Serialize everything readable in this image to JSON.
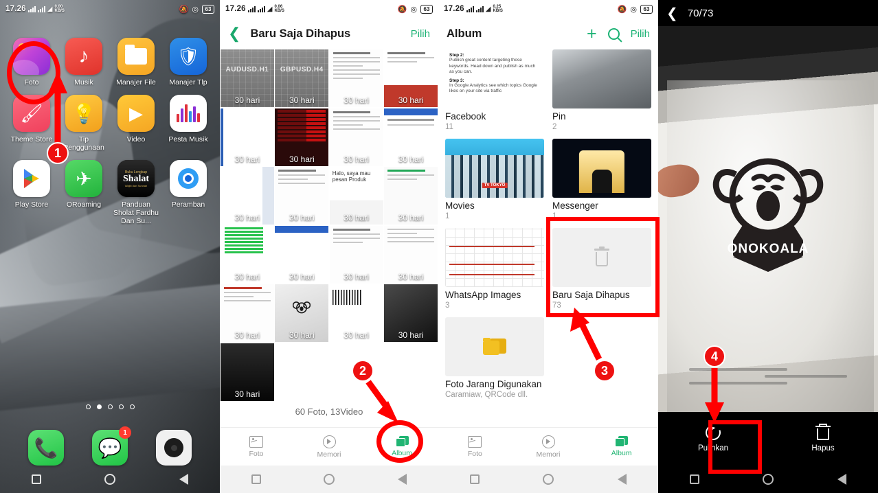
{
  "panels": {
    "home": {
      "status": {
        "time": "17.26",
        "speed_value": "0.00",
        "speed_unit": "KB/S",
        "battery": "63"
      },
      "apps": [
        {
          "label": "Foto",
          "icon": "photos-icon"
        },
        {
          "label": "Musik",
          "icon": "music-note-icon"
        },
        {
          "label": "Manajer File",
          "icon": "folder-icon"
        },
        {
          "label": "Manajer Tlp",
          "icon": "shield-bolt-icon"
        },
        {
          "label": "Theme Store",
          "icon": "brush-icon"
        },
        {
          "label": "Tip Penggunaan",
          "icon": "lightbulb-icon"
        },
        {
          "label": "Video",
          "icon": "play-triangle-icon"
        },
        {
          "label": "Pesta Musik",
          "icon": "equalizer-icon"
        },
        {
          "label": "Play Store",
          "icon": "play-store-icon"
        },
        {
          "label": "ORoaming",
          "icon": "airplane-icon"
        },
        {
          "label": "Panduan Sholat Fardhu Dan Su...",
          "icon": "shalat-book-icon"
        },
        {
          "label": "Peramban",
          "icon": "browser-icon"
        }
      ],
      "shalat_cover": {
        "top": "Buku Lengkap",
        "main": "Shalat",
        "bottom": "Wajib dan Sunnah"
      },
      "page_dots": 5,
      "active_dot": 1,
      "dock": [
        {
          "label": "Phone",
          "icon": "phone-icon",
          "badge": ""
        },
        {
          "label": "Messages",
          "icon": "message-icon",
          "badge": "1"
        },
        {
          "label": "Camera",
          "icon": "camera-icon",
          "badge": ""
        }
      ]
    },
    "recently_deleted": {
      "status": {
        "time": "17.26",
        "speed_value": "0.06",
        "speed_unit": "KB/S",
        "battery": "63"
      },
      "back_icon": "chevron-left-icon",
      "title": "Baru Saja Dihapus",
      "select_label": "Pilih",
      "footer_count": "60 Foto, 13Video",
      "thumb_badge": "30 hari",
      "thumbs": [
        {
          "kind": "chart",
          "caption": "AUDUSD.H1"
        },
        {
          "kind": "chart",
          "caption": "GBPUSD.H4"
        },
        {
          "kind": "doc",
          "caption": ""
        },
        {
          "kind": "chart-red",
          "caption": ""
        },
        {
          "kind": "white-chart",
          "caption": ""
        },
        {
          "kind": "red-table",
          "caption": ""
        },
        {
          "kind": "doc",
          "caption": ""
        },
        {
          "kind": "doc-blue",
          "caption": ""
        },
        {
          "kind": "white-chart",
          "caption": ""
        },
        {
          "kind": "doc",
          "caption": ""
        },
        {
          "kind": "wa",
          "caption": "Halo, saya mau pesan Produk"
        },
        {
          "kind": "doc",
          "caption": ""
        },
        {
          "kind": "green-table",
          "caption": ""
        },
        {
          "kind": "blue-chart",
          "caption": ""
        },
        {
          "kind": "doc",
          "caption": ""
        },
        {
          "kind": "doc",
          "caption": ""
        },
        {
          "kind": "doc",
          "caption": ""
        },
        {
          "kind": "bag",
          "caption": ""
        },
        {
          "kind": "barcode",
          "caption": ""
        },
        {
          "kind": "dark",
          "caption": ""
        },
        {
          "kind": "night",
          "caption": ""
        }
      ],
      "tabs": [
        {
          "label": "Foto",
          "icon": "photo-tab-icon",
          "active": false
        },
        {
          "label": "Memori",
          "icon": "memory-tab-icon",
          "active": false
        },
        {
          "label": "Album",
          "icon": "album-tab-icon",
          "active": true
        }
      ]
    },
    "album_list": {
      "status": {
        "time": "17.26",
        "speed_value": "0.25",
        "speed_unit": "KB/S",
        "battery": "63"
      },
      "title": "Album",
      "add_icon": "plus-icon",
      "search_icon": "search-icon",
      "select_label": "Pilih",
      "albums": [
        {
          "name": "Facebook",
          "sub": "11",
          "thumb": "fb"
        },
        {
          "name": "Pin",
          "sub": "2",
          "thumb": "pin"
        },
        {
          "name": "Movies",
          "sub": "1",
          "thumb": "movies"
        },
        {
          "name": "Messenger",
          "sub": "1",
          "thumb": "mess"
        },
        {
          "name": "WhatsApp Images",
          "sub": "3",
          "thumb": "whats"
        },
        {
          "name": "Baru Saja Dihapus",
          "sub": "73",
          "thumb": "deleted"
        },
        {
          "name": "Foto Jarang Digunakan",
          "sub": "Caramiaw, QRCode dll.",
          "thumb": "rare"
        }
      ],
      "fb_thumb_text": {
        "step2_head": "Step 2:",
        "step2_body": "Publish great content targeting those keywords. Head down and publish as much as you can.",
        "step3_head": "Step 3:",
        "step3_body": "In Google Analytics see which topics Google likes on your site via traffic"
      },
      "tabs": [
        {
          "label": "Foto",
          "icon": "photo-tab-icon",
          "active": false
        },
        {
          "label": "Memori",
          "icon": "memory-tab-icon",
          "active": false
        },
        {
          "label": "Album",
          "icon": "album-tab-icon",
          "active": true
        }
      ]
    },
    "viewer": {
      "back_icon": "chevron-left-icon",
      "counter": "70/73",
      "brand_on_bag": "ONOKOALA",
      "actions": [
        {
          "label": "Pulihkan",
          "icon": "restore-icon"
        },
        {
          "label": "Hapus",
          "icon": "trash-icon"
        }
      ]
    }
  },
  "annotations": {
    "accent": "#ff0000",
    "steps": [
      {
        "number": "1",
        "target": "foto-app-icon"
      },
      {
        "number": "2",
        "target": "album-tab"
      },
      {
        "number": "3",
        "target": "baru-saja-dihapus-album"
      },
      {
        "number": "4",
        "target": "pulihkan-button"
      }
    ]
  }
}
